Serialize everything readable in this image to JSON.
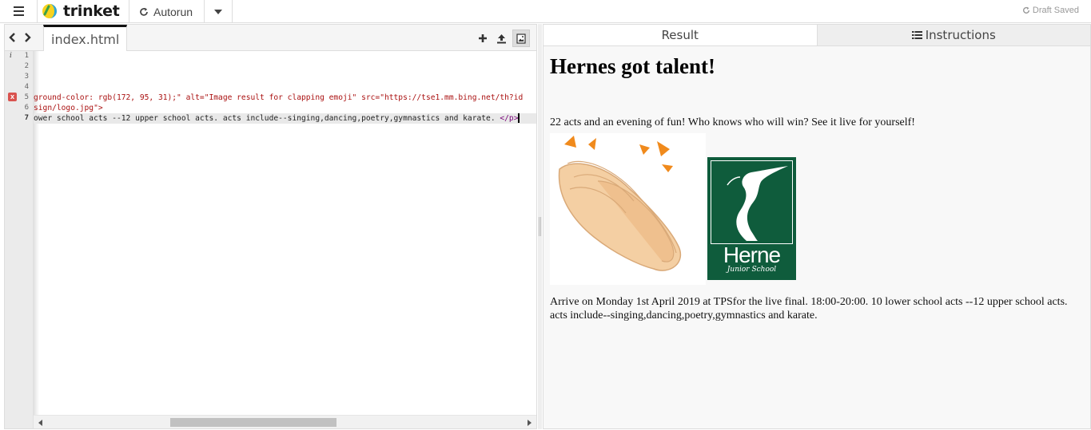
{
  "topbar": {
    "logo_text": "trinket",
    "autorun_label": "Autorun",
    "status": "Draft Saved"
  },
  "editor": {
    "tab_label": "index.html",
    "line_numbers": [
      "1",
      "2",
      "3",
      "4",
      "5",
      "6",
      "7"
    ],
    "info_marker": "i",
    "error_marker": "x",
    "lines": [
      "",
      "",
      "",
      "",
      "ground-color: rgb(172, 95, 31);\" alt=\"Image result for clapping emoji\" src=\"https://tse1.mm.bing.net/th?id",
      "sign/logo.jpg\">",
      "ower school acts --12 upper school acts. acts include--singing,dancing,poetry,gymnastics and karate. "
    ],
    "line7_tag": "</p>"
  },
  "result": {
    "tabs": {
      "result": "Result",
      "instructions": "Instructions"
    },
    "heading": "Hernes got talent!",
    "intro": "22 acts and an evening of fun! Who knows who will win? See it live for yourself!",
    "logo_name": "Herne",
    "logo_sub": "Junior School",
    "details": "Arrive on Monday 1st April 2019 at TPSfor the live final. 18:00-20:00. 10 lower school acts --12 upper school acts. acts include--singing,dancing,poetry,gymnastics and karate."
  },
  "colors": {
    "herne_green": "#0f5c3c",
    "clap_burst": "#f08a1c",
    "error_red": "#d9534f"
  },
  "icons": {
    "menu": "menu-icon",
    "refresh": "refresh-icon",
    "caret": "caret-down-icon",
    "back": "chevron-left-icon",
    "forward": "chevron-right-icon",
    "add_file": "plus-icon",
    "upload": "upload-icon",
    "image": "image-icon",
    "list": "list-icon"
  }
}
